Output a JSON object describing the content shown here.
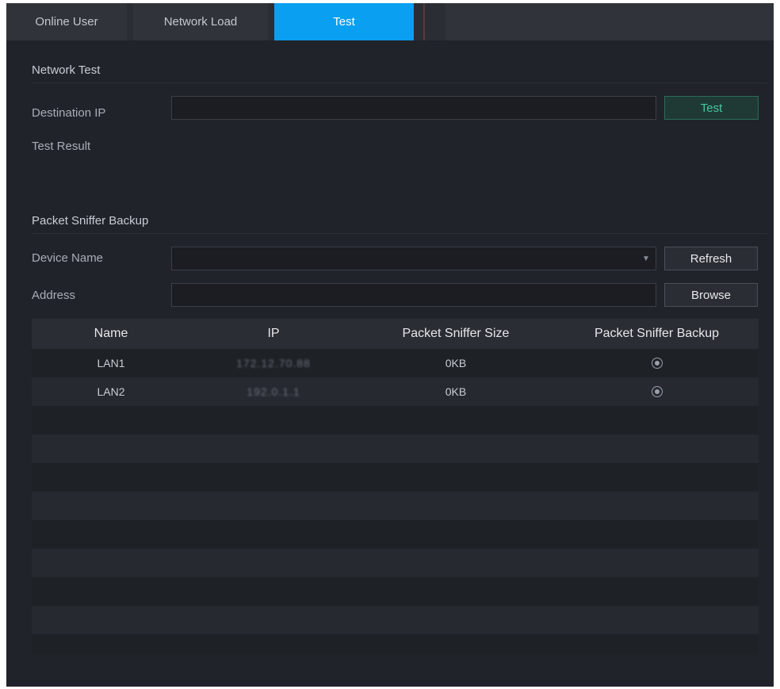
{
  "tabs": [
    {
      "label": "Online User",
      "active": false
    },
    {
      "label": "Network Load",
      "active": false
    },
    {
      "label": "Test",
      "active": true
    }
  ],
  "network_test": {
    "title": "Network Test",
    "destination_label": "Destination IP",
    "destination_value": "",
    "test_button": "Test",
    "result_label": "Test Result"
  },
  "sniffer": {
    "title": "Packet Sniffer Backup",
    "device_label": "Device Name",
    "device_value": "",
    "refresh_button": "Refresh",
    "address_label": "Address",
    "address_value": "",
    "browse_button": "Browse",
    "columns": [
      "Name",
      "IP",
      "Packet Sniffer Size",
      "Packet Sniffer Backup"
    ],
    "rows": [
      {
        "name": "LAN1",
        "ip": "172.12.70.88",
        "size": "0KB"
      },
      {
        "name": "LAN2",
        "ip": "192.0.1.1",
        "size": "0KB"
      }
    ]
  },
  "colors": {
    "accent": "#0a9ff0",
    "panel": "#20232a",
    "test_button_text": "#48c8a0"
  },
  "icons": {
    "dropdown": "chevron-down-icon",
    "backup": "radio-record-icon"
  }
}
